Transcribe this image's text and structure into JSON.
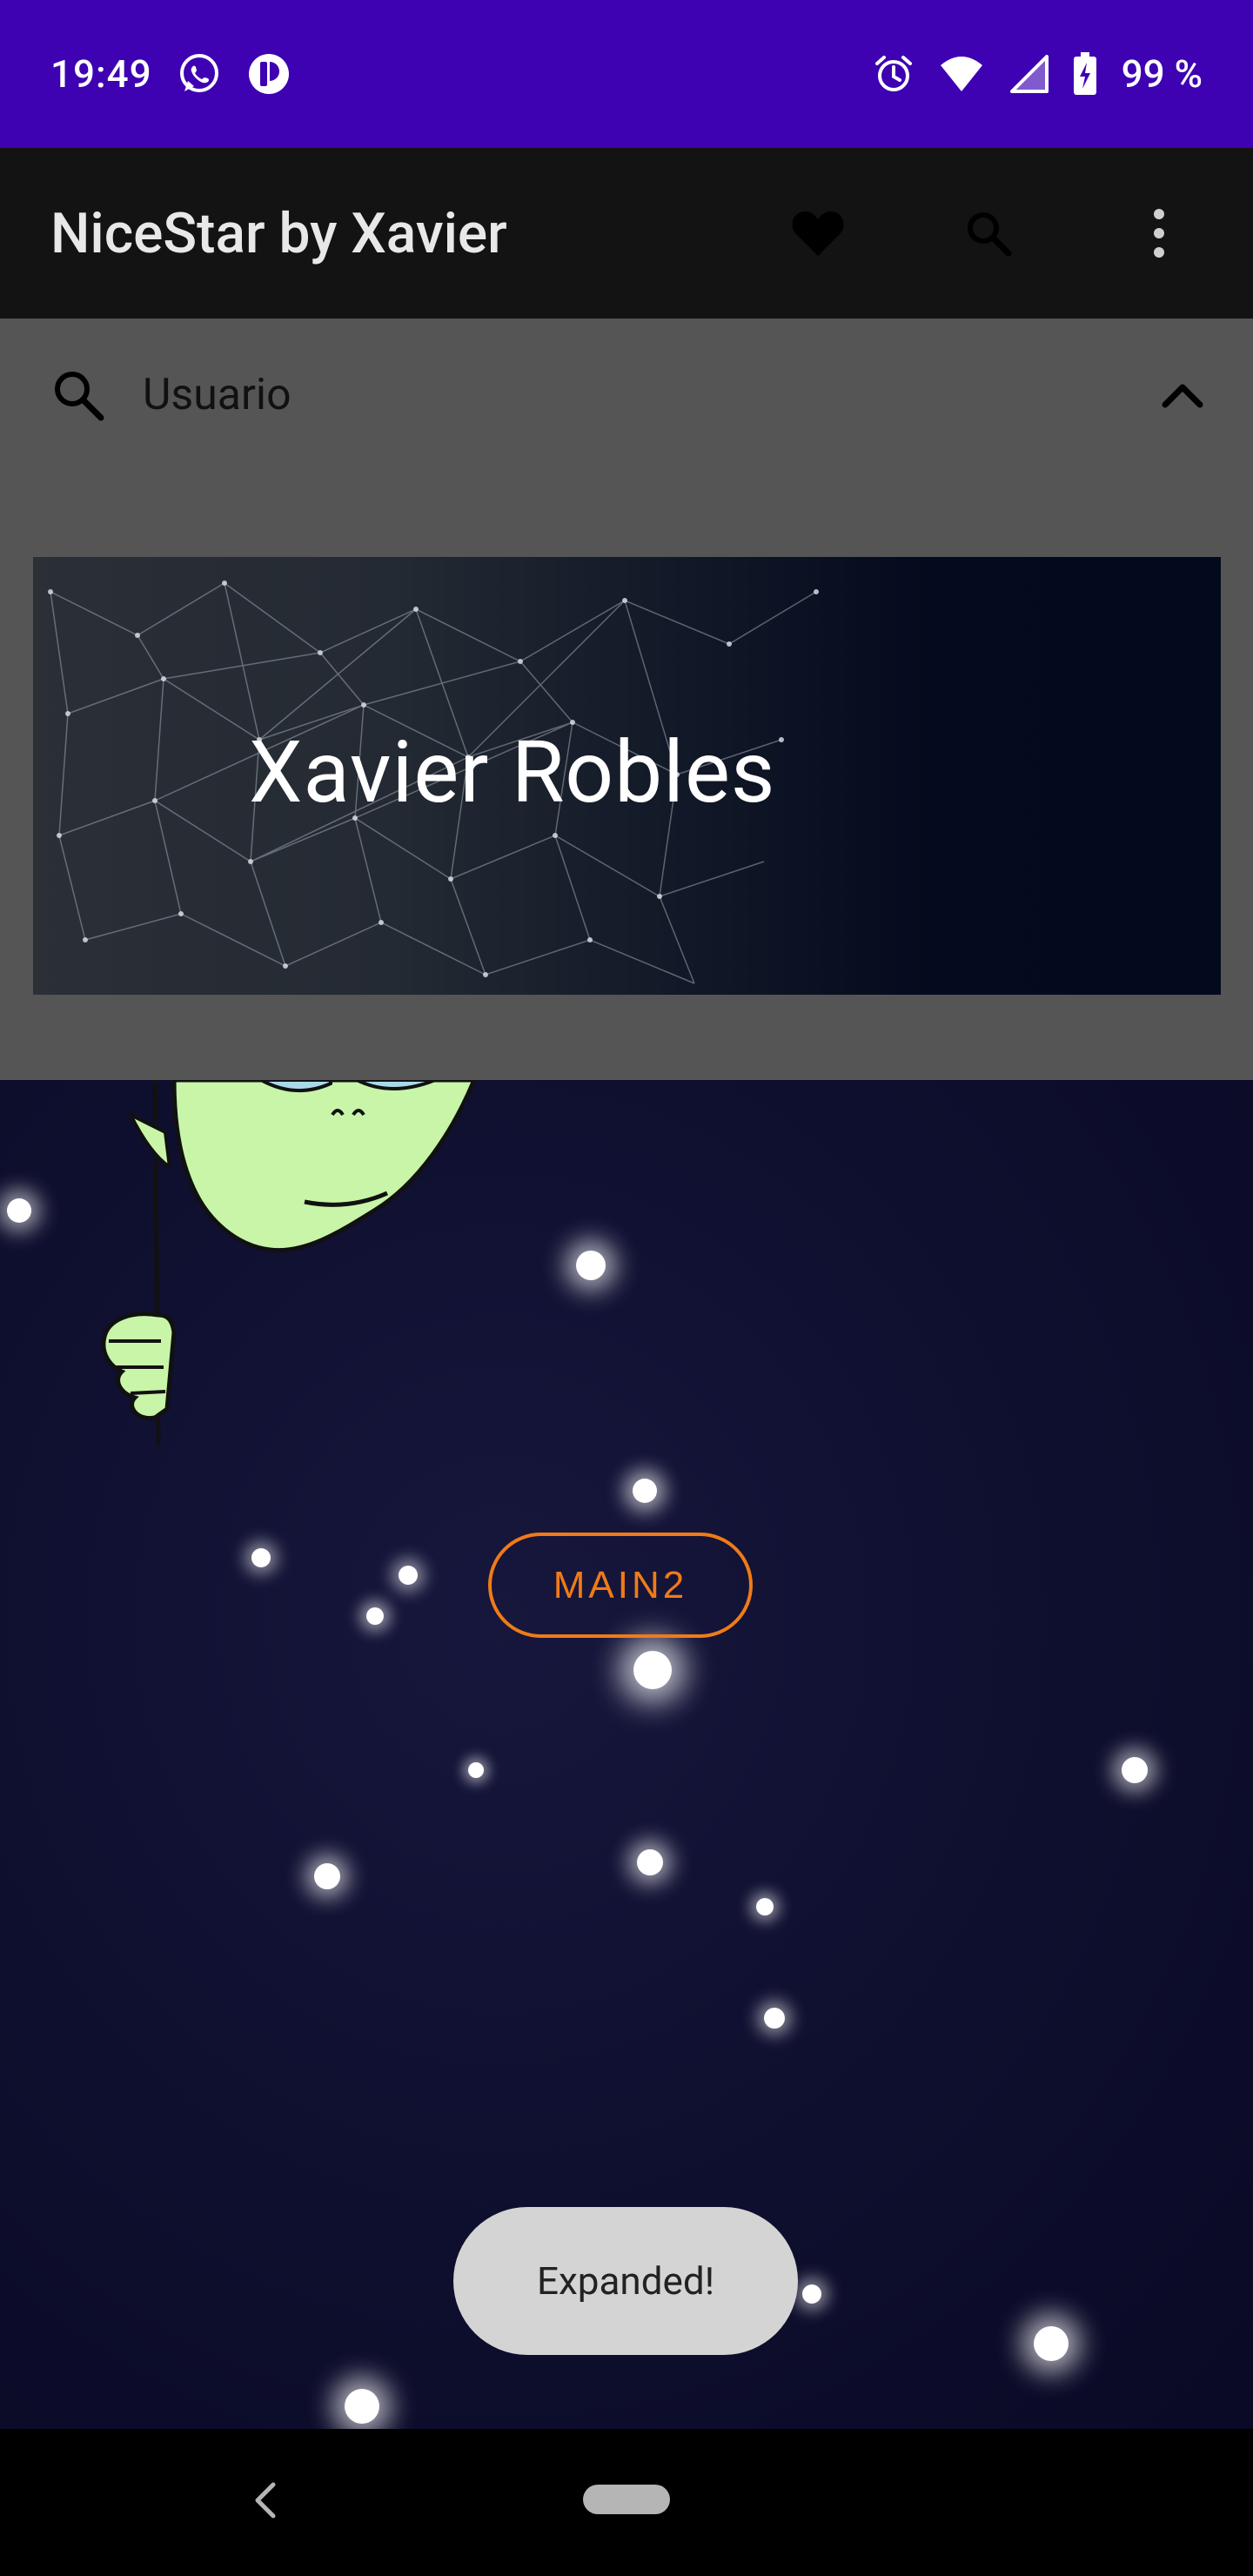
{
  "status_bar": {
    "time": "19:49",
    "battery": "99 %",
    "left_icons": [
      "whatsapp-icon",
      "app-notification-icon"
    ],
    "right_icons": [
      "alarm-icon",
      "wifi-icon",
      "signal-icon",
      "battery-charging-icon"
    ],
    "background": "#3e02b3"
  },
  "app_bar": {
    "title": "NiceStar by Xavier",
    "actions": [
      "heart-icon",
      "search-icon",
      "more-vert-icon"
    ],
    "background": "#131313"
  },
  "search": {
    "label": "Usuario",
    "expanded": true
  },
  "header": {
    "name": "Xavier Robles"
  },
  "main": {
    "button_label": "MAIN2",
    "accent": "#f07b17"
  },
  "toast": {
    "text": "Expanded!"
  },
  "nav_bar": {
    "icons": [
      "back-icon",
      "home-pill"
    ]
  }
}
